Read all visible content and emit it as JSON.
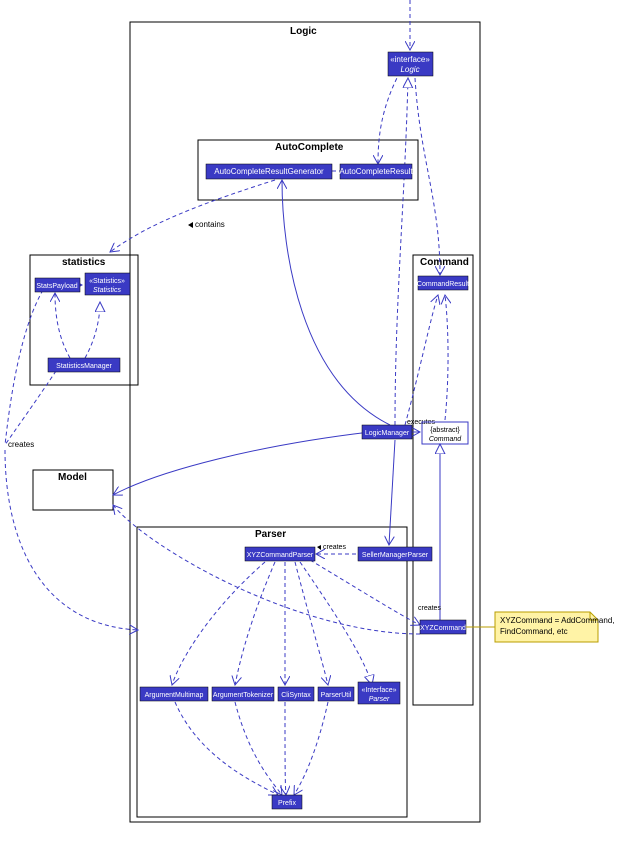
{
  "packages": {
    "logic": "Logic",
    "autocomplete": "AutoComplete",
    "statistics": "statistics",
    "command": "Command",
    "model": "Model",
    "parser": "Parser"
  },
  "nodes": {
    "logic_if_stereo": "«interface»",
    "logic_if": "Logic",
    "ac_gen": "AutoCompleteResultGenerator",
    "ac_res": "AutoCompleteResult",
    "stats_payload": "StatsPayload",
    "stats_if_stereo": "«Statistics»",
    "stats_if": "Statistics",
    "stats_mgr": "StatisticsManager",
    "cmd_result": "CommandResult",
    "abs_cmd_stereo": "{abstract}",
    "abs_cmd": "Command",
    "logic_mgr": "LogicManager",
    "xyz_cmd": "XYZCommand",
    "xyz_parser": "XYZCommandParser",
    "sm_parser": "SellerManagerParser",
    "arg_multimap": "ArgumentMultimap",
    "arg_tok": "ArgumentTokenizer",
    "cli_syn": "CliSyntax",
    "parser_util": "ParserUtil",
    "parser_if_stereo": "«Interface»",
    "parser_if": "Parser",
    "prefix": "Prefix"
  },
  "labels": {
    "contains": "contains",
    "creates1": "creates",
    "executes": "executes",
    "creates2": "creates",
    "creates3": "creates"
  },
  "note": {
    "l1": "XYZCommand = AddCommand,",
    "l2": "FindCommand, etc"
  }
}
